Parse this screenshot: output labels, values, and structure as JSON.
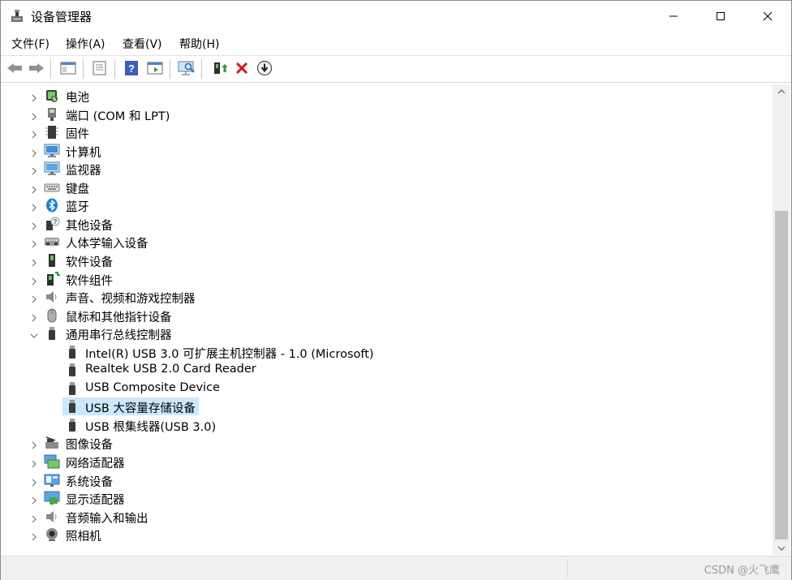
{
  "window": {
    "title": "设备管理器"
  },
  "menu": [
    "文件(F)",
    "操作(A)",
    "查看(V)",
    "帮助(H)"
  ],
  "toolbar": [
    "back-icon",
    "forward-icon",
    "show-hide-console-tree-icon",
    "properties-icon",
    "help-icon",
    "action-pane-icon",
    "scan-hardware-icon",
    "update-driver-icon",
    "uninstall-icon",
    "disable-icon"
  ],
  "tree": {
    "items": [
      {
        "label": "电池",
        "icon": "battery-icon",
        "expanded": false
      },
      {
        "label": "端口 (COM 和 LPT)",
        "icon": "port-icon",
        "expanded": false
      },
      {
        "label": "固件",
        "icon": "firmware-icon",
        "expanded": false
      },
      {
        "label": "计算机",
        "icon": "computer-icon",
        "expanded": false
      },
      {
        "label": "监视器",
        "icon": "monitor-icon",
        "expanded": false
      },
      {
        "label": "键盘",
        "icon": "keyboard-icon",
        "expanded": false
      },
      {
        "label": "蓝牙",
        "icon": "bluetooth-icon",
        "expanded": false
      },
      {
        "label": "其他设备",
        "icon": "other-devices-icon",
        "expanded": false
      },
      {
        "label": "人体学输入设备",
        "icon": "hid-icon",
        "expanded": false
      },
      {
        "label": "软件设备",
        "icon": "software-device-icon",
        "expanded": false
      },
      {
        "label": "软件组件",
        "icon": "software-component-icon",
        "expanded": false
      },
      {
        "label": "声音、视频和游戏控制器",
        "icon": "sound-icon",
        "expanded": false
      },
      {
        "label": "鼠标和其他指针设备",
        "icon": "mouse-icon",
        "expanded": false
      },
      {
        "label": "通用串行总线控制器",
        "icon": "usb-controller-icon",
        "expanded": true,
        "children": [
          {
            "label": "Intel(R) USB 3.0 可扩展主机控制器 - 1.0 (Microsoft)",
            "icon": "usb-plug-icon"
          },
          {
            "label": "Realtek USB 2.0 Card Reader",
            "icon": "usb-plug-icon"
          },
          {
            "label": "USB Composite Device",
            "icon": "usb-plug-icon"
          },
          {
            "label": "USB 大容量存储设备",
            "icon": "usb-plug-icon",
            "selected": true
          },
          {
            "label": "USB 根集线器(USB 3.0)",
            "icon": "usb-plug-icon"
          }
        ]
      },
      {
        "label": "图像设备",
        "icon": "imaging-icon",
        "expanded": false
      },
      {
        "label": "网络适配器",
        "icon": "network-icon",
        "expanded": false
      },
      {
        "label": "系统设备",
        "icon": "system-device-icon",
        "expanded": false
      },
      {
        "label": "显示适配器",
        "icon": "display-adapter-icon",
        "expanded": false
      },
      {
        "label": "音频输入和输出",
        "icon": "audio-io-icon",
        "expanded": false
      },
      {
        "label": "照相机",
        "icon": "camera-icon",
        "expanded": false
      }
    ]
  },
  "watermark": "CSDN @火飞鹰",
  "colors": {
    "selection": "#cce8ff",
    "accent": "#0078d7"
  }
}
